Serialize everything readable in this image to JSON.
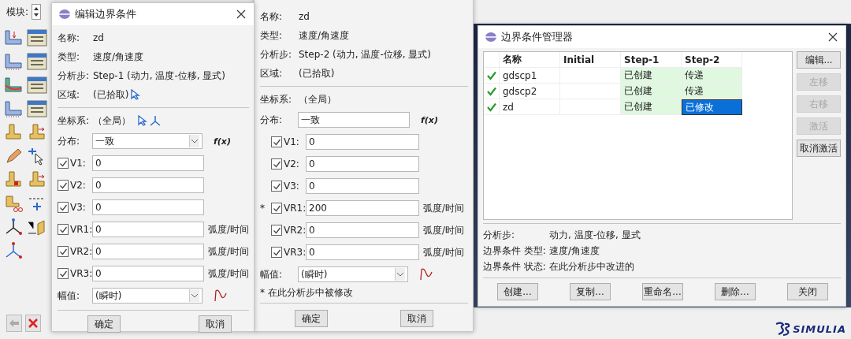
{
  "app": {
    "module_label": "模块:",
    "logo_text": "SIMULIA",
    "toolbar": [
      {
        "kind": "bc"
      },
      {
        "kind": "manager"
      },
      {
        "kind": "bc-fixed"
      },
      {
        "kind": "manager"
      },
      {
        "kind": "bc-field"
      },
      {
        "kind": "manager"
      },
      {
        "kind": "bc-fixed"
      },
      {
        "kind": "manager"
      },
      {
        "kind": "load-a"
      },
      {
        "kind": "load-b"
      },
      {
        "kind": "pencil"
      },
      {
        "kind": "pick"
      },
      {
        "kind": "part-a"
      },
      {
        "kind": "part-b"
      },
      {
        "kind": "part-c"
      },
      {
        "kind": "xyz"
      },
      {
        "kind": "triad"
      },
      {
        "kind": "plane"
      },
      {
        "kind": "triad-red"
      }
    ]
  },
  "edit_dialogs": [
    {
      "title": "编辑边界条件",
      "info": [
        {
          "label": "名称:",
          "value": "zd",
          "pick": false
        },
        {
          "label": "类型:",
          "value": "速度/角速度",
          "pick": false
        },
        {
          "label": "分析步:",
          "value": "Step-1 (动力, 温度-位移, 显式)",
          "pick": false
        },
        {
          "label": "区域:",
          "value": "(已拾取)",
          "pick": true
        }
      ],
      "csys_label": "坐标系:",
      "csys": "（全局）",
      "csys_tools": true,
      "distribution_label": "分布:",
      "distribution": {
        "kind": "dropdown",
        "value": "一致"
      },
      "fx": "f(x)",
      "components": [
        {
          "label": "V1:",
          "checked": true,
          "value": "0"
        },
        {
          "label": "V2:",
          "checked": true,
          "value": "0"
        },
        {
          "label": "V3:",
          "checked": true,
          "value": "0"
        },
        {
          "label": "VR1:",
          "checked": true,
          "value": "0",
          "unit": "弧度/时间"
        },
        {
          "label": "VR2:",
          "checked": true,
          "value": "0",
          "unit": "弧度/时间"
        },
        {
          "label": "VR3:",
          "checked": true,
          "value": "0",
          "unit": "弧度/时间"
        }
      ],
      "amplitude_label": "幅值:",
      "amplitude": "(瞬时)",
      "buttons": [
        "确定",
        "取消"
      ]
    },
    {
      "info": [
        {
          "label": "名称:",
          "value": "zd",
          "pick": false
        },
        {
          "label": "类型:",
          "value": "速度/角速度",
          "pick": false
        },
        {
          "label": "分析步:",
          "value": "Step-2 (动力, 温度-位移, 显式)",
          "pick": false
        },
        {
          "label": "区域:",
          "value": "(已拾取)",
          "pick": false
        }
      ],
      "csys_label": "坐标系:",
      "csys": "（全局）",
      "csys_tools": false,
      "distribution_label": "分布:",
      "distribution": {
        "kind": "field",
        "value": "一致"
      },
      "fx": "f(x)",
      "components": [
        {
          "label": "V1:",
          "checked": true,
          "value": "0"
        },
        {
          "label": "V2:",
          "checked": true,
          "value": "0"
        },
        {
          "label": "V3:",
          "checked": true,
          "value": "0"
        },
        {
          "label": "VR1:",
          "checked": true,
          "value": "200",
          "unit": "弧度/时间",
          "mark": "*"
        },
        {
          "label": "VR2:",
          "checked": true,
          "value": "0",
          "unit": "弧度/时间"
        },
        {
          "label": "VR3:",
          "checked": true,
          "value": "0",
          "unit": "弧度/时间"
        }
      ],
      "amplitude_label": "幅值:",
      "amplitude": "(瞬时)",
      "note": "* 在此分析步中被修改",
      "buttons": [
        "确定",
        "取消"
      ]
    }
  ],
  "manager": {
    "title": "边界条件管理器",
    "columns": [
      "名称",
      "Initial",
      "Step-1",
      "Step-2"
    ],
    "rows": [
      {
        "active": true,
        "name": "gdscp1",
        "steps": [
          {
            "text": "已创建",
            "selected": false
          },
          {
            "text": "传递",
            "selected": false
          }
        ]
      },
      {
        "active": true,
        "name": "gdscp2",
        "steps": [
          {
            "text": "已创建",
            "selected": false
          },
          {
            "text": "传递",
            "selected": false
          }
        ]
      },
      {
        "active": true,
        "name": "zd",
        "steps": [
          {
            "text": "已创建",
            "selected": false
          },
          {
            "text": "已修改",
            "selected": true
          }
        ]
      }
    ],
    "side_buttons": [
      {
        "label": "编辑...",
        "disabled": false
      },
      {
        "label": "左移",
        "disabled": true
      },
      {
        "label": "右移",
        "disabled": true
      },
      {
        "label": "激活",
        "disabled": true
      },
      {
        "label": "取消激活",
        "disabled": false
      }
    ],
    "info": [
      {
        "label": "分析步:",
        "value": "动力, 温度-位移, 显式"
      },
      {
        "label": "边界条件 类型:",
        "value": "速度/角速度"
      },
      {
        "label": "边界条件 状态:",
        "value": "在此分析步中改进的"
      }
    ],
    "buttons": [
      "创建...",
      "复制...",
      "重命名...",
      "删除...",
      "关闭"
    ]
  }
}
